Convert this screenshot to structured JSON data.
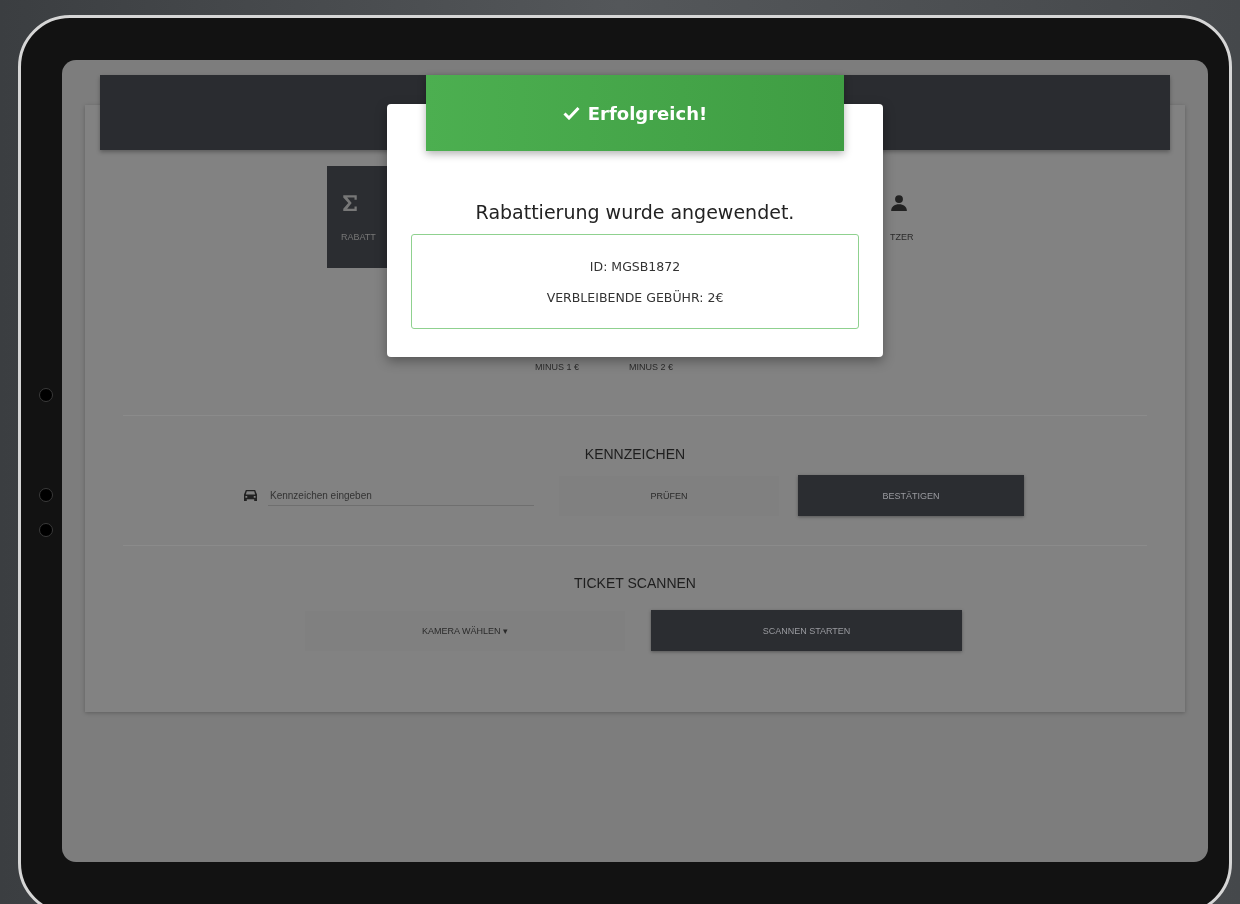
{
  "tiles": [
    {
      "label": "RABATT",
      "selected": true
    },
    {
      "label": "TZER",
      "selected": false
    }
  ],
  "discount_options": [
    "MINUS 1 €",
    "MINUS 2 €"
  ],
  "plate": {
    "title": "KENNZEICHEN",
    "placeholder": "Kennzeichen eingeben",
    "check": "PRÜFEN",
    "confirm": "BESTÄTIGEN"
  },
  "ticket": {
    "title": "TICKET SCANNEN",
    "camera": "KAMERA WÄHLEN",
    "camera_caret": "▾",
    "start": "SCANNEN STARTEN"
  },
  "modal": {
    "toast": "Erfolgreich!",
    "message": "Rabattierung wurde angewendet.",
    "details": [
      "ID: MGSB1872",
      "VERBLEIBENDE GEBÜHR: 2€"
    ]
  }
}
